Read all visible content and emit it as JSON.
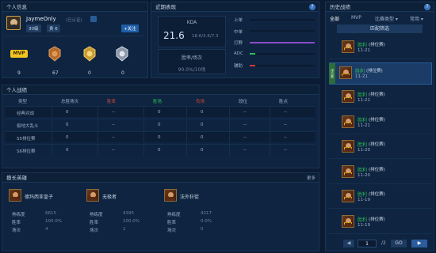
{
  "profile": {
    "title": "个人信息",
    "name": "JaymeOnly",
    "tag": "(已认证)",
    "level": "30级",
    "rank": "贵 6",
    "follow": "+关注",
    "medals": [
      {
        "name": "mvp",
        "count": "9",
        "label": "MVP"
      },
      {
        "name": "bronze",
        "count": "67"
      },
      {
        "name": "gold",
        "count": "0"
      },
      {
        "name": "silver",
        "count": "0"
      }
    ]
  },
  "recent": {
    "title": "近期表现",
    "kda_label": "KDA",
    "kda_value": "21.6",
    "kda_detail": "18.6/3.6/7.3",
    "winrate_label": "胜率/场次",
    "winrate_value": "90.0%/10场",
    "roles": [
      {
        "label": "上单",
        "fill": 0.0,
        "color": "#8b4cc8"
      },
      {
        "label": "中单",
        "fill": 0.0,
        "color": "#8b4cc8"
      },
      {
        "label": "打野",
        "fill": 1.0,
        "color": "#8b4cc8"
      },
      {
        "label": "ADC",
        "fill": 0.08,
        "color": "#2fbf5a"
      },
      {
        "label": "辅助",
        "fill": 0.08,
        "color": "#d03a3a"
      }
    ]
  },
  "stats": {
    "title": "个人战绩",
    "columns": [
      "类型",
      "总胜场次",
      "胜率",
      "胜场",
      "负场",
      "段位",
      "胜点"
    ],
    "column_colors": [
      "#9fb0c8",
      "#9fb0c8",
      "#d3483a",
      "#2fbf5a",
      "#d3483a",
      "#9fb0c8",
      "#9fb0c8"
    ],
    "rows": [
      [
        "经典对战",
        "0",
        "--",
        "0",
        "0",
        "--",
        "--"
      ],
      [
        "极地大乱斗",
        "0",
        "--",
        "0",
        "0",
        "--",
        "--"
      ],
      [
        "S5排位赛",
        "0",
        "--",
        "0",
        "0",
        "--",
        "--"
      ],
      [
        "S6排位赛",
        "0",
        "--",
        "0",
        "0",
        "--",
        "--"
      ]
    ]
  },
  "heroes": {
    "title": "擅长英雄",
    "more": "更多",
    "list": [
      {
        "name": "德玛西亚皇子",
        "rows": [
          [
            "熟练度",
            "6615"
          ],
          [
            "胜率",
            "100.0%"
          ],
          [
            "场次",
            "4"
          ]
        ]
      },
      {
        "name": "无极者",
        "rows": [
          [
            "熟练度",
            "4395"
          ],
          [
            "胜率",
            "100.0%"
          ],
          [
            "场次",
            "1"
          ]
        ]
      },
      {
        "name": "法外狂徒",
        "rows": [
          [
            "熟练度",
            "4217"
          ],
          [
            "胜率",
            "0.0%"
          ],
          [
            "场次",
            "0"
          ]
        ]
      }
    ]
  },
  "history": {
    "title": "历史战绩",
    "tabs": [
      "全部",
      "MVP",
      "比赛类型 ▾",
      "常用 ▾"
    ],
    "filter_label": "匹配筛选",
    "matches": [
      {
        "result": "胜利",
        "mode": "(排位赛)",
        "date": "11-21",
        "selected": false
      },
      {
        "result": "胜利",
        "mode": "(排位赛)",
        "date": "11-21",
        "selected": true
      },
      {
        "result": "胜利",
        "mode": "(排位赛)",
        "date": "11-21",
        "selected": false
      },
      {
        "result": "胜利",
        "mode": "(排位赛)",
        "date": "11-21",
        "selected": false
      },
      {
        "result": "胜利",
        "mode": "(排位赛)",
        "date": "11-20",
        "selected": false
      },
      {
        "result": "胜利",
        "mode": "(排位赛)",
        "date": "11-20",
        "selected": false
      },
      {
        "result": "胜利",
        "mode": "(排位赛)",
        "date": "11-19",
        "selected": false
      },
      {
        "result": "胜利",
        "mode": "(排位赛)",
        "date": "11-19",
        "selected": false
      }
    ],
    "selected_tag": "排位赛",
    "page_current": "1",
    "page_total": "/2",
    "go_label": "GO"
  }
}
